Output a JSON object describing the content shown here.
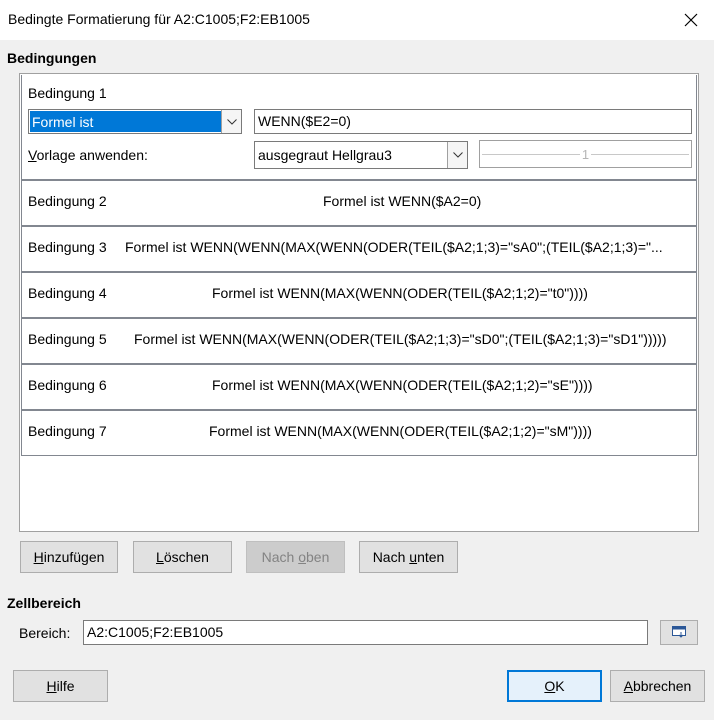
{
  "window": {
    "title": "Bedingte Formatierung für A2:C1005;F2:EB1005",
    "close_icon": "close-icon"
  },
  "conditions_section": {
    "title": "Bedingungen",
    "condition1": {
      "label": "Bedingung 1",
      "type_value": "Formel ist",
      "formula": "WENN($E2=0)",
      "style_label_prefix": "V",
      "style_label_rest": "orlage anwenden:",
      "style_value": "ausgegraut Hellgrau3",
      "preview_text": "1"
    },
    "conditions": [
      {
        "label": "Bedingung 2",
        "desc": "Formel ist  WENN($A2=0)"
      },
      {
        "label": "Bedingung 3",
        "desc": "Formel ist  WENN(WENN(MAX(WENN(ODER(TEIL($A2;1;3)=\"sA0\";(TEIL($A2;1;3)=\"..."
      },
      {
        "label": "Bedingung 4",
        "desc": "Formel ist  WENN(MAX(WENN(ODER(TEIL($A2;1;2)=\"t0\"))))"
      },
      {
        "label": "Bedingung 5",
        "desc": "Formel ist  WENN(MAX(WENN(ODER(TEIL($A2;1;3)=\"sD0\";(TEIL($A2;1;3)=\"sD1\")))))"
      },
      {
        "label": "Bedingung 6",
        "desc": "Formel ist  WENN(MAX(WENN(ODER(TEIL($A2;1;2)=\"sE\"))))"
      },
      {
        "label": "Bedingung 7",
        "desc": "Formel ist  WENN(MAX(WENN(ODER(TEIL($A2;1;2)=\"sM\"))))"
      }
    ]
  },
  "condition_buttons": {
    "add": {
      "prefix": "",
      "mnemonic": "H",
      "rest": "inzufügen"
    },
    "delete": {
      "prefix": "",
      "mnemonic": "L",
      "rest": "öschen"
    },
    "up": {
      "prefix": "Nach ",
      "mnemonic": "o",
      "rest": "ben"
    },
    "down": {
      "prefix": "Nach ",
      "mnemonic": "u",
      "rest": "nten"
    }
  },
  "cell_range": {
    "title": "Zellbereich",
    "label": "Bereich:",
    "value": "A2:C1005;F2:EB1005"
  },
  "footer_buttons": {
    "help": {
      "mnemonic": "H",
      "rest": "ilfe"
    },
    "ok": {
      "mnemonic": "O",
      "rest": "K"
    },
    "cancel": {
      "mnemonic": "A",
      "rest": "bbrechen"
    }
  }
}
